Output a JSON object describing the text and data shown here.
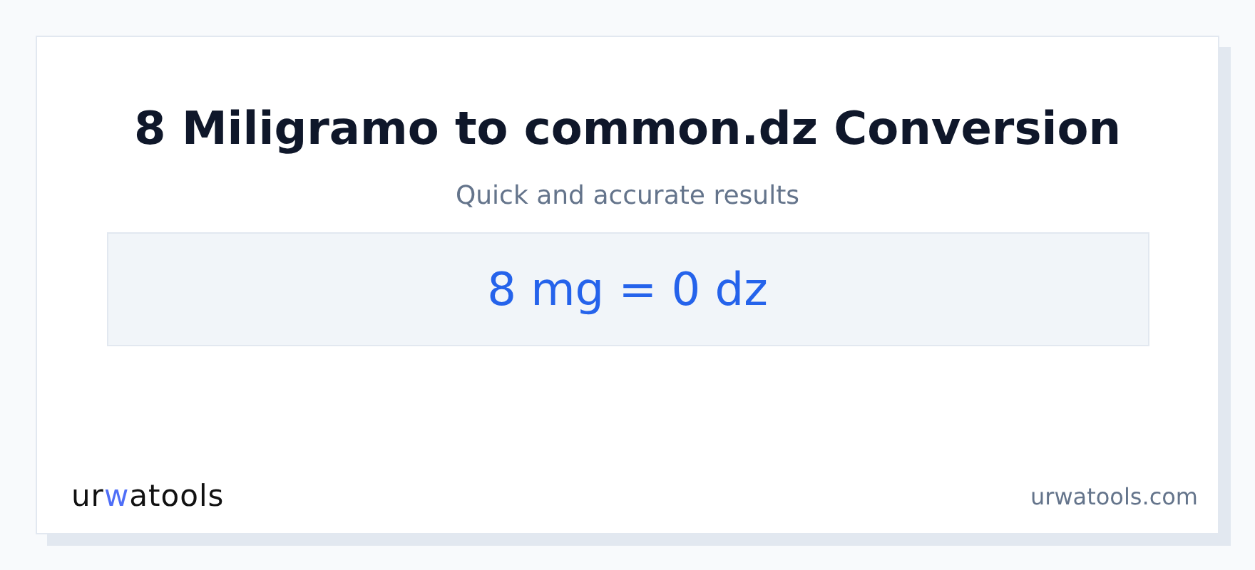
{
  "title": "8 Miligramo to common.dz Conversion",
  "subtitle": "Quick and accurate results",
  "result": "8 mg = 0 dz",
  "logo": {
    "before": "ur",
    "accent": "w",
    "after": "atools"
  },
  "site": "urwatools.com"
}
